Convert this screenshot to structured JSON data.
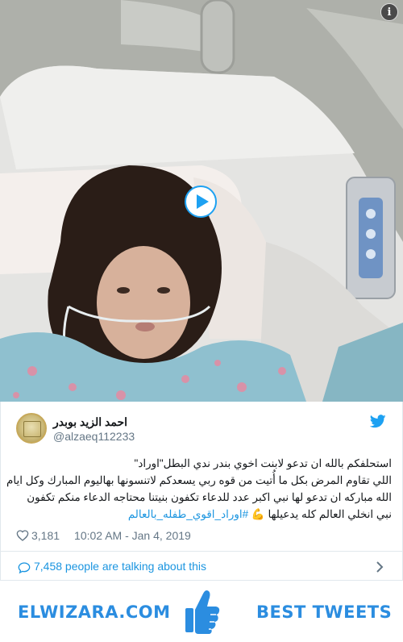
{
  "media": {
    "info_icon": "info-icon",
    "play_icon": "play-icon"
  },
  "tweet": {
    "author_name": "احمد الزيد بوبدر",
    "author_handle": "@alzaeq112233",
    "text_lines": [
      "استحلفكم بالله ان تدعو لابنت اخوي بندر ندي البطل\"اوراد\"",
      "اللي تقاوم المرض بكل ما أُتيت من قوه ربي يسعدكم لاتنسونها بهاليوم المبارك وكل ايام",
      "الله مباركه ان تدعو لها نبي اكبر عدد للدعاء تكفون بنيتنا محتاجه الدعاء منكم تكفون"
    ],
    "last_line_text": "نبي انخلي العالم كله يدعيلها 💪",
    "hashtag": "#اوراد_اقوي_طفله_بالعالم",
    "likes": "3,181",
    "timestamp": "10:02 AM - Jan 4, 2019",
    "talking": "7,458 people are talking about this"
  },
  "footer": {
    "site": "ELWIZARA.COM",
    "tagline": "BEST TWEETS"
  },
  "colors": {
    "link": "#1b95e0",
    "brand": "#2b8de0",
    "muted": "#657786"
  }
}
